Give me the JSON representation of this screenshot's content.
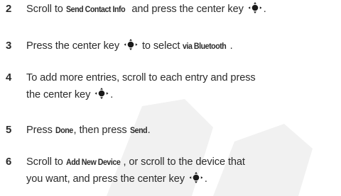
{
  "steps": [
    {
      "number": "2",
      "parts": {
        "a": "Scroll to ",
        "ui1": "Send Contact Info",
        "b": " and press the center key ",
        "c": "."
      }
    },
    {
      "number": "3",
      "parts": {
        "a": "Press the center key ",
        "b": " to select ",
        "ui1": "via Bluetooth",
        "c": "."
      }
    },
    {
      "number": "4",
      "parts": {
        "a": "To add more entries, scroll to each entry and press",
        "b": "the center key ",
        "c": "."
      }
    },
    {
      "number": "5",
      "parts": {
        "a": "Press ",
        "ui1": "Done",
        "b": ", then press ",
        "ui2": "Send",
        "c": "."
      }
    },
    {
      "number": "6",
      "parts": {
        "a": "Scroll to ",
        "ui1": "Add New Device",
        "b": ", or scroll to the device that",
        "c": "you want, and press the center key ",
        "d": "."
      }
    }
  ],
  "icons": {
    "center_key": "nav-center-key-icon"
  },
  "colors": {
    "text": "#2b2b2b",
    "watermark": "#f1f1f1"
  }
}
